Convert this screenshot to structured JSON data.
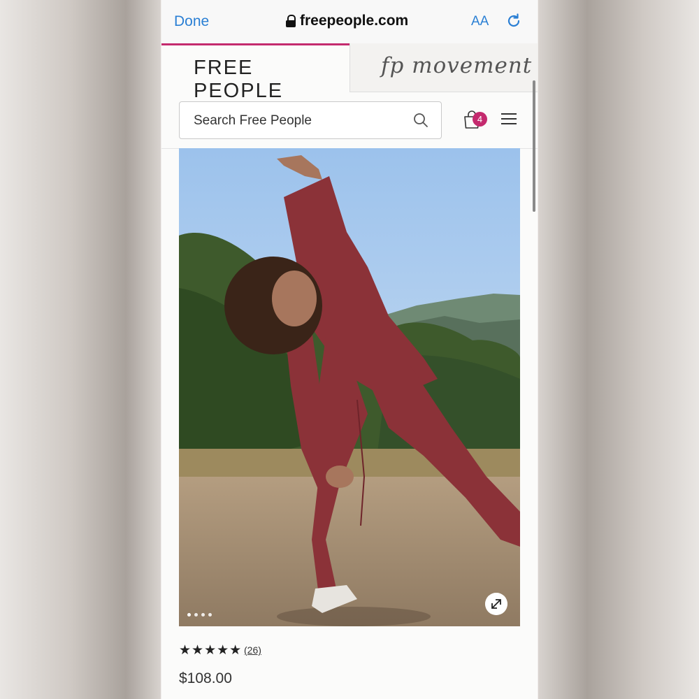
{
  "browser": {
    "done_label": "Done",
    "url": "freepeople.com",
    "text_size_label": "AA",
    "reload_icon": "reload-icon",
    "accent_color": "#2a7fd4"
  },
  "brand_tabs": {
    "primary": "FREE PEOPLE",
    "secondary": "fp movement"
  },
  "search": {
    "placeholder": "Search Free People"
  },
  "cart": {
    "count": "4",
    "badge_color": "#c42a6e"
  },
  "product": {
    "carousel": {
      "total_images": 4,
      "current_index": 1
    },
    "rating_stars": "★★★★★",
    "rating_value": 5,
    "review_count": "(26)",
    "price": "$108.00"
  }
}
